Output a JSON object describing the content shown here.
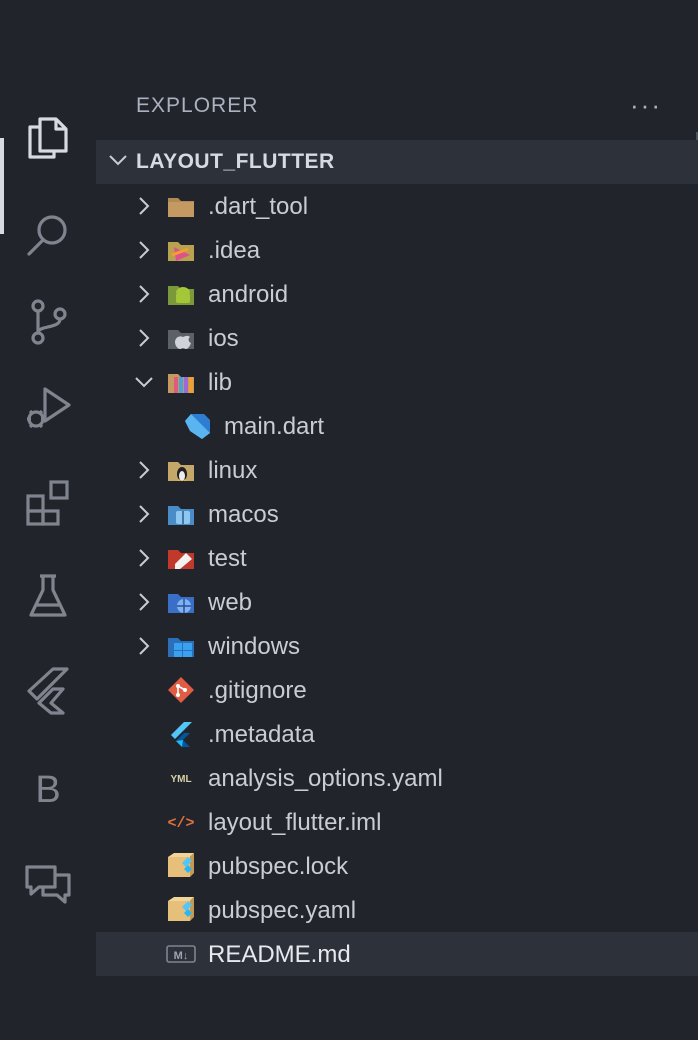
{
  "explorer": {
    "title": "EXPLORER",
    "more_actions": "···",
    "section_title": "LAYOUT_FLUTTER"
  },
  "activity_bar": {
    "items": [
      {
        "name": "explorer",
        "icon": "files-icon",
        "active": true
      },
      {
        "name": "search",
        "icon": "search-icon"
      },
      {
        "name": "source-control",
        "icon": "source-control-icon"
      },
      {
        "name": "run-and-debug",
        "icon": "run-debug-icon"
      },
      {
        "name": "extensions",
        "icon": "extensions-icon"
      },
      {
        "name": "testing",
        "icon": "flask-icon"
      },
      {
        "name": "flutter",
        "icon": "flutter-icon"
      },
      {
        "name": "b-extension",
        "label": "B"
      },
      {
        "name": "comments",
        "icon": "comments-icon"
      }
    ]
  },
  "tree": [
    {
      "label": ".dart_tool",
      "type": "folder",
      "icon": "folder-dart-tool-icon",
      "expanded": false
    },
    {
      "label": ".idea",
      "type": "folder",
      "icon": "folder-idea-icon",
      "expanded": false
    },
    {
      "label": "android",
      "type": "folder",
      "icon": "folder-android-icon",
      "expanded": false
    },
    {
      "label": "ios",
      "type": "folder",
      "icon": "folder-ios-icon",
      "expanded": false
    },
    {
      "label": "lib",
      "type": "folder",
      "icon": "folder-lib-icon",
      "expanded": true
    },
    {
      "label": "main.dart",
      "type": "file",
      "icon": "dart-file-icon",
      "nested": true
    },
    {
      "label": "linux",
      "type": "folder",
      "icon": "folder-linux-icon",
      "expanded": false
    },
    {
      "label": "macos",
      "type": "folder",
      "icon": "folder-macos-icon",
      "expanded": false
    },
    {
      "label": "test",
      "type": "folder",
      "icon": "folder-test-icon",
      "expanded": false
    },
    {
      "label": "web",
      "type": "folder",
      "icon": "folder-web-icon",
      "expanded": false
    },
    {
      "label": "windows",
      "type": "folder",
      "icon": "folder-windows-icon",
      "expanded": false
    },
    {
      "label": ".gitignore",
      "type": "file",
      "icon": "git-file-icon"
    },
    {
      "label": ".metadata",
      "type": "file",
      "icon": "flutter-file-icon"
    },
    {
      "label": "analysis_options.yaml",
      "type": "file",
      "icon": "yaml-file-icon",
      "icon_text": "YML"
    },
    {
      "label": "layout_flutter.iml",
      "type": "file",
      "icon": "xml-file-icon",
      "icon_text": "</>"
    },
    {
      "label": "pubspec.lock",
      "type": "file",
      "icon": "pubspec-file-icon"
    },
    {
      "label": "pubspec.yaml",
      "type": "file",
      "icon": "pubspec-file-icon"
    },
    {
      "label": "README.md",
      "type": "file",
      "icon": "markdown-file-icon",
      "icon_text": "M↓",
      "selected": true
    }
  ],
  "colors": {
    "background": "#21252b",
    "selected_row": "#2c313a",
    "text": "#c8ccd4",
    "icon_muted": "#7f848e"
  }
}
